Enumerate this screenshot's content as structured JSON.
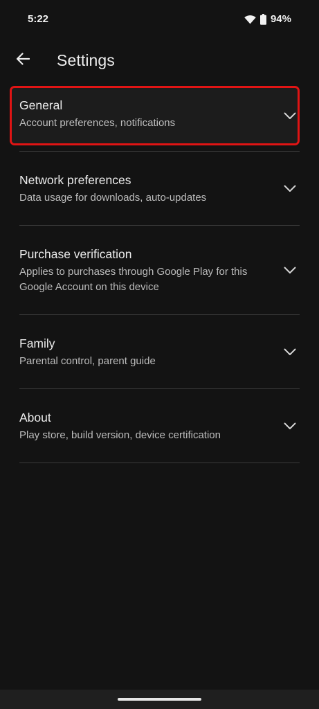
{
  "status_bar": {
    "time": "5:22",
    "battery_percent": "94%",
    "icons": [
      "wifi-icon",
      "battery-icon"
    ]
  },
  "app_bar": {
    "title": "Settings",
    "back_icon": "arrow-left-icon"
  },
  "settings": {
    "items": [
      {
        "title": "General",
        "subtitle": "Account preferences, notifications",
        "highlighted": true
      },
      {
        "title": "Network preferences",
        "subtitle": "Data usage for downloads, auto-updates"
      },
      {
        "title": "Purchase verification",
        "subtitle": "Applies to purchases through Google Play for this Google Account on this device"
      },
      {
        "title": "Family",
        "subtitle": "Parental control, parent guide"
      },
      {
        "title": "About",
        "subtitle": "Play store, build version, device certification"
      }
    ]
  },
  "colors": {
    "background": "#131313",
    "highlight_border": "#e01414",
    "divider": "#3a3a3a"
  }
}
